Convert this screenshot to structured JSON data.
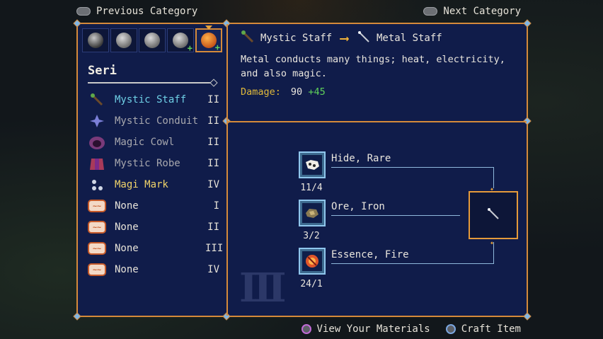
{
  "nav": {
    "prev_label": "Previous Category",
    "next_label": "Next Category"
  },
  "character": {
    "name": "Seri"
  },
  "tabs": [
    {
      "icon": "character-portrait-icon",
      "has_plus": false,
      "active": false
    },
    {
      "icon": "character-portrait-icon",
      "has_plus": false,
      "active": false
    },
    {
      "icon": "character-portrait-icon",
      "has_plus": false,
      "active": false
    },
    {
      "icon": "character-portrait-icon",
      "has_plus": true,
      "active": false
    },
    {
      "icon": "character-portrait-icon",
      "has_plus": true,
      "active": true
    }
  ],
  "items": [
    {
      "label": "Mystic Staff",
      "tier": "II",
      "state": "selected",
      "icon": "staff-icon"
    },
    {
      "label": "Mystic Conduit",
      "tier": "II",
      "state": "normal",
      "icon": "conduit-icon"
    },
    {
      "label": "Magic Cowl",
      "tier": "II",
      "state": "normal",
      "icon": "cowl-icon"
    },
    {
      "label": "Mystic Robe",
      "tier": "II",
      "state": "normal",
      "icon": "robe-icon"
    },
    {
      "label": "Magi Mark",
      "tier": "IV",
      "state": "highlight",
      "icon": "amulet-icon"
    },
    {
      "label": "None",
      "tier": "I",
      "state": "none",
      "icon": "empty-slot-icon"
    },
    {
      "label": "None",
      "tier": "II",
      "state": "none",
      "icon": "empty-slot-icon"
    },
    {
      "label": "None",
      "tier": "III",
      "state": "none",
      "icon": "empty-slot-icon"
    },
    {
      "label": "None",
      "tier": "IV",
      "state": "none",
      "icon": "empty-slot-icon"
    }
  ],
  "upgrade": {
    "from": "Mystic Staff",
    "to": "Metal Staff",
    "description": "Metal conducts many things; heat, electricity, and also magic.",
    "damage_label": "Damage:",
    "damage_base": "90",
    "damage_bonus": "+45"
  },
  "materials": [
    {
      "name": "Hide, Rare",
      "count": "11/4",
      "icon": "hide-icon"
    },
    {
      "name": "Ore, Iron",
      "count": "3/2",
      "icon": "ore-icon"
    },
    {
      "name": "Essence, Fire",
      "count": "24/1",
      "icon": "fire-essence-icon"
    }
  ],
  "tier_display": "III",
  "bottom": {
    "view_materials": "View Your Materials",
    "craft": "Craft Item"
  },
  "colors": {
    "panel_bg": "#101c4a",
    "border": "#d58a3a",
    "selected_text": "#6fd0e6",
    "highlight_text": "#f1d46a",
    "bonus_green": "#5fd15a"
  }
}
